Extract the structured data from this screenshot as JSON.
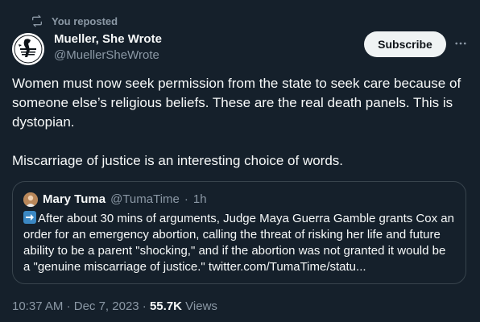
{
  "repost": {
    "label": "You reposted",
    "icon": "repost-icon"
  },
  "author": {
    "name": "Mueller, She Wrote",
    "handle": "@MuellerSheWrote",
    "avatar_icon": "avatar-logo"
  },
  "actions": {
    "subscribe_label": "Subscribe",
    "more_icon": "more-options-icon"
  },
  "tweet": {
    "paragraphs": [
      "Women must now seek permission from the state to seek care because of someone else’s religious beliefs. These are the real death panels. This is dystopian.",
      "Miscarriage of justice is an interesting choice of words."
    ]
  },
  "quote": {
    "author_name": "Mary Tuma",
    "author_handle": "@TumaTime",
    "separator": "·",
    "time": "1h",
    "emoji_icon": "right-arrow-emoji",
    "text": "After about 30 mins of arguments, Judge Maya Guerra Gamble grants Cox an order for an emergency abortion, calling the threat of risking her life and future ability to be a parent \"shocking,\" and if the abortion was not granted it would be a  \"genuine miscarriage of justice.\" twitter.com/TumaTime/statu..."
  },
  "meta": {
    "time": "10:37 AM",
    "date": "Dec 7, 2023",
    "separator": "·",
    "views_count": "55.7K",
    "views_label": "Views"
  },
  "colors": {
    "background": "#15202b",
    "text": "#f7f9f9",
    "muted": "#8b98a5",
    "border": "#38444d",
    "button_bg": "#eff3f4"
  }
}
